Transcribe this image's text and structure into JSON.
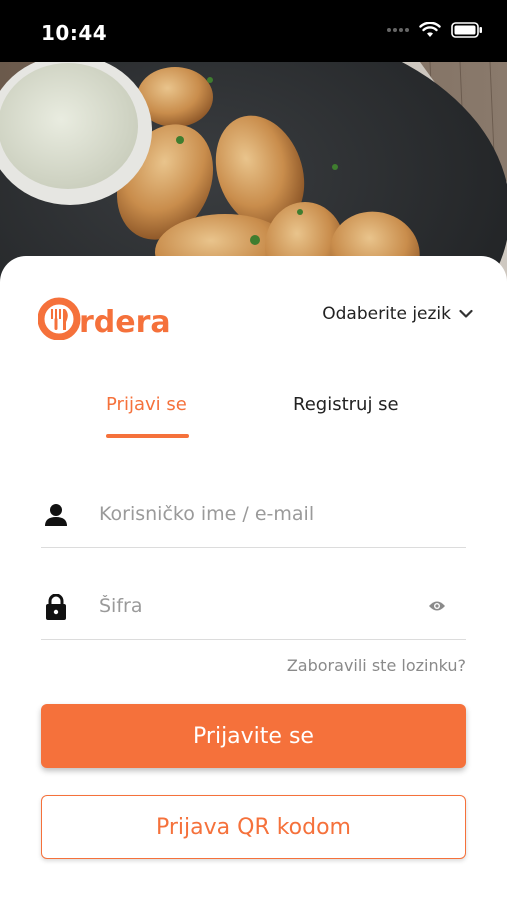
{
  "status_bar": {
    "time": "10:44"
  },
  "header": {
    "brand": "Ordera",
    "language_label": "Odaberite jezik"
  },
  "tabs": [
    {
      "label": "Prijavi se",
      "active": true
    },
    {
      "label": "Registruj se",
      "active": false
    }
  ],
  "form": {
    "username_placeholder": "Korisničko ime / e-mail",
    "password_placeholder": "Šifra",
    "forgot_label": "Zaboravili ste lozinku?"
  },
  "buttons": {
    "login_label": "Prijavite se",
    "qr_label": "Prijava QR kodom"
  },
  "icons": [
    "signal-dots-icon",
    "wifi-icon",
    "battery-icon",
    "chevron-down-icon",
    "user-icon",
    "lock-icon",
    "eye-icon"
  ],
  "colors": {
    "accent": "#f5713b",
    "text": "#222222",
    "muted": "#9a9a9a"
  }
}
